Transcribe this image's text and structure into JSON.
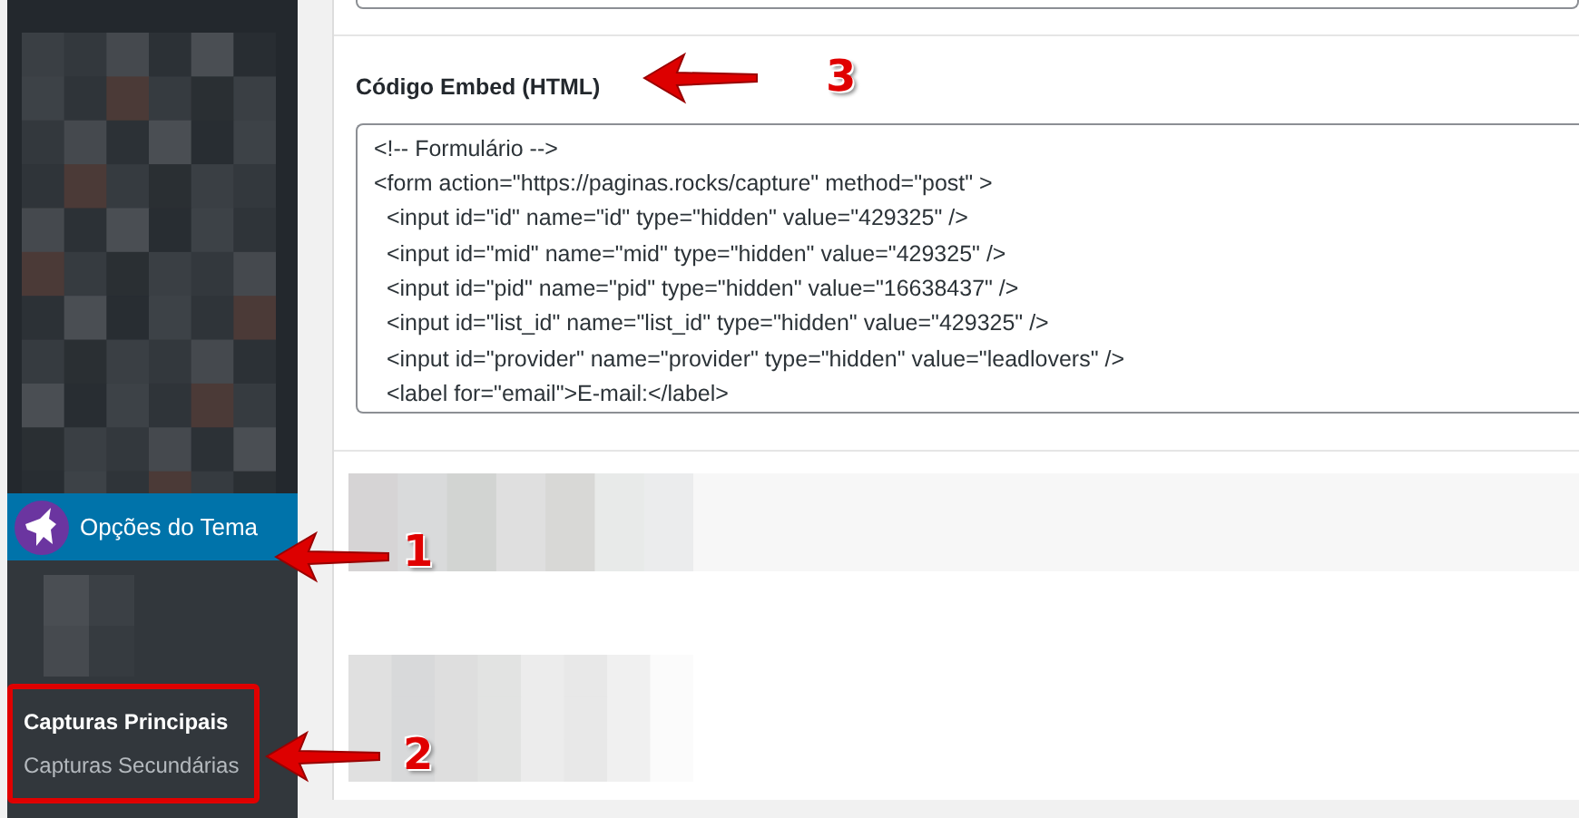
{
  "sidebar": {
    "menu": [
      {
        "label": "Opções do Tema",
        "selected": true
      }
    ],
    "submenu": [
      {
        "label": "Capturas Principais",
        "selected": true
      },
      {
        "label": "Capturas Secundárias",
        "selected": false
      }
    ]
  },
  "main": {
    "embed_field": {
      "label": "Código Embed (HTML)",
      "value": "<!-- Formulário -->\n<form action=\"https://paginas.rocks/capture\" method=\"post\" >\n  <input id=\"id\" name=\"id\" type=\"hidden\" value=\"429325\" />\n  <input id=\"mid\" name=\"mid\" type=\"hidden\" value=\"429325\" />\n  <input id=\"pid\" name=\"pid\" type=\"hidden\" value=\"16638437\" />\n  <input id=\"list_id\" name=\"list_id\" type=\"hidden\" value=\"429325\" />\n  <input id=\"provider\" name=\"provider\" type=\"hidden\" value=\"leadlovers\" />\n  <label for=\"email\">E-mail:</label>"
    }
  },
  "annotations": [
    {
      "label": "1"
    },
    {
      "label": "2"
    },
    {
      "label": "3"
    }
  ]
}
